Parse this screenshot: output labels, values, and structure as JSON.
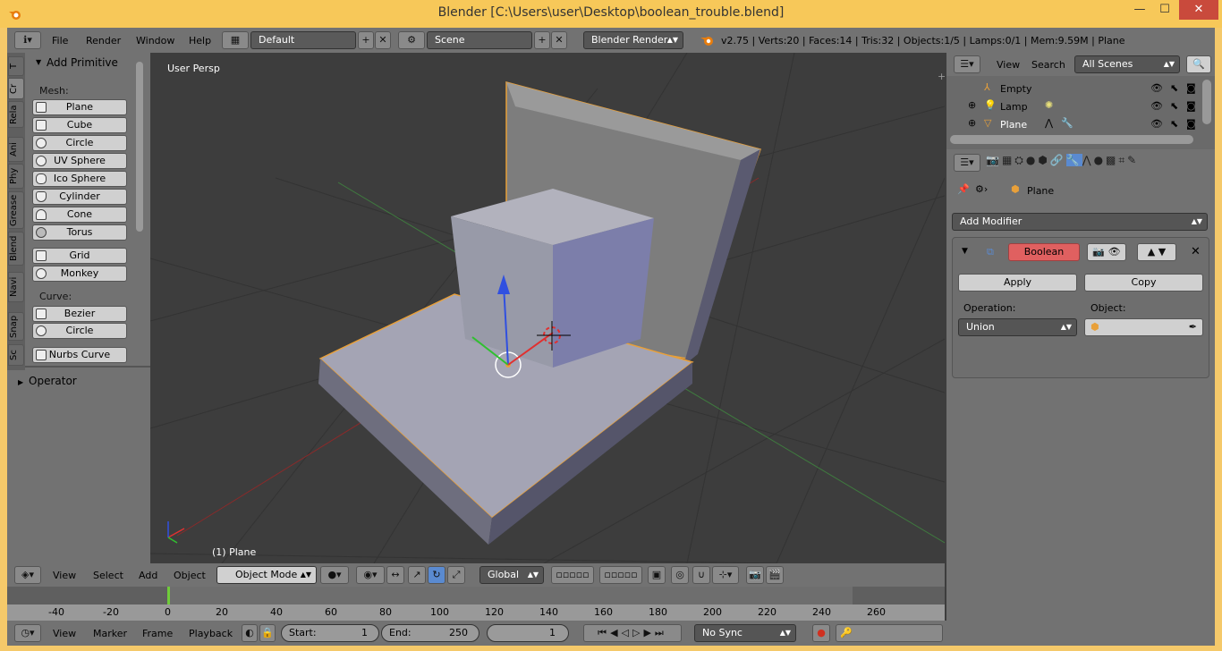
{
  "window": {
    "title": "Blender [C:\\Users\\user\\Desktop\\boolean_trouble.blend]",
    "minimize": "—",
    "maximize": "☐",
    "close": "✕"
  },
  "topbar": {
    "menus": [
      "File",
      "Render",
      "Window",
      "Help"
    ],
    "layout": "Default",
    "scene": "Scene",
    "engine": "Blender Render",
    "stats": "v2.75 | Verts:20 | Faces:14 | Tris:32 | Objects:1/5 | Lamps:0/1 | Mem:9.59M | Plane"
  },
  "tools": {
    "tabs": [
      "T",
      "Cr",
      "Rela",
      "Ani",
      "Phy",
      "Grease",
      "Blend",
      "Navi",
      "Snap",
      "Sc"
    ],
    "panel_title": "Add Primitive",
    "mesh_label": "Mesh:",
    "mesh": [
      "Plane",
      "Cube",
      "Circle",
      "UV Sphere",
      "Ico Sphere",
      "Cylinder",
      "Cone",
      "Torus"
    ],
    "extra": [
      "Grid",
      "Monkey"
    ],
    "curve_label": "Curve:",
    "curve": [
      "Bezier",
      "Circle",
      "Nurbs Curve"
    ],
    "operator": "Operator"
  },
  "viewport": {
    "label": "User Persp",
    "object_label": "(1) Plane"
  },
  "view_header": {
    "menus": [
      "View",
      "Select",
      "Add",
      "Object"
    ],
    "mode": "Object Mode",
    "orientation": "Global"
  },
  "outliner": {
    "menus": [
      "View",
      "Search"
    ],
    "scenes": "All Scenes",
    "items": [
      "Empty",
      "Lamp",
      "Plane"
    ]
  },
  "properties": {
    "breadcrumb": "Plane",
    "add_modifier": "Add Modifier",
    "modifier_name": "Boolean",
    "apply": "Apply",
    "copy": "Copy",
    "operation_label": "Operation:",
    "operation": "Union",
    "object_label": "Object:"
  },
  "timeline": {
    "ticks": [
      "-40",
      "-20",
      "0",
      "20",
      "40",
      "60",
      "80",
      "100",
      "120",
      "140",
      "160",
      "180",
      "200",
      "220",
      "240",
      "260"
    ],
    "current_frame": "1"
  },
  "timeline_header": {
    "menus": [
      "View",
      "Marker",
      "Frame",
      "Playback"
    ],
    "start_label": "Start:",
    "start": "1",
    "end_label": "End:",
    "end": "250",
    "frame": "1",
    "sync": "No Sync"
  }
}
